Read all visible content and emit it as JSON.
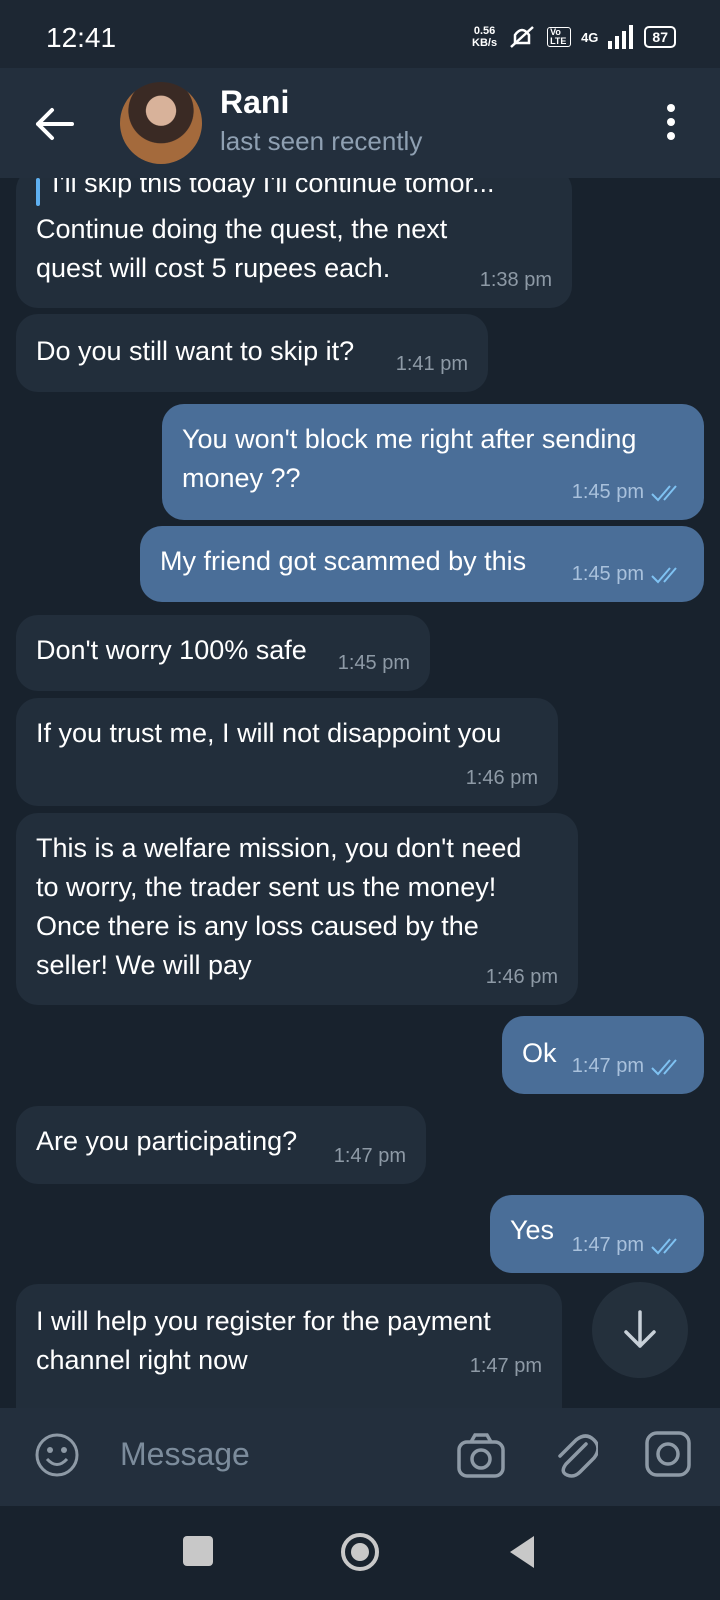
{
  "status": {
    "time": "12:41",
    "net_speed": "0.56",
    "net_unit": "KB/s",
    "volte": "Vo LTE",
    "network": "4G",
    "battery": "87"
  },
  "header": {
    "name": "Rani",
    "status": "last seen recently"
  },
  "messages": [
    {
      "reply_preview": "I'll skip this today I'll continue tomor...",
      "text": [
        "Continue doing the quest, the next",
        "quest will cost 5 rupees each."
      ],
      "time": "1:38 pm",
      "outgoing": false
    },
    {
      "text": [
        "Do you still want to skip it?"
      ],
      "time": "1:41 pm",
      "outgoing": false
    },
    {
      "text": [
        "You won't block me right after sending",
        "money ??"
      ],
      "time": "1:45 pm",
      "outgoing": true
    },
    {
      "text": [
        "My friend got scammed by this"
      ],
      "time": "1:45 pm",
      "outgoing": true
    },
    {
      "text": [
        "Don't worry 100% safe"
      ],
      "time": "1:45 pm",
      "outgoing": false
    },
    {
      "text": [
        "If you trust me, I will not disappoint you"
      ],
      "time": "1:46 pm",
      "outgoing": false
    },
    {
      "text": [
        "This is a welfare mission, you don't need",
        "to worry, the trader sent us the money!",
        "Once there is any loss caused by the",
        "seller! We will pay"
      ],
      "time": "1:46 pm",
      "outgoing": false
    },
    {
      "text": [
        "Ok"
      ],
      "time": "1:47 pm",
      "outgoing": true
    },
    {
      "text": [
        "Are you participating?"
      ],
      "time": "1:47 pm",
      "outgoing": false
    },
    {
      "text": [
        "Yes"
      ],
      "time": "1:47 pm",
      "outgoing": true
    },
    {
      "text": [
        "I will help you register for the payment",
        "channel right now"
      ],
      "time": "1:47 pm",
      "outgoing": false
    }
  ],
  "input": {
    "placeholder": "Message"
  },
  "icons": {
    "back": "arrow-left-icon",
    "menu": "more-vertical-icon",
    "emoji": "smiley-icon",
    "camera": "camera-icon",
    "attach": "paperclip-icon",
    "video": "video-message-icon",
    "scroll_down": "arrow-down-icon"
  },
  "colors": {
    "background": "#18222d",
    "incoming": "#222e3b",
    "outgoing": "#4a6e98",
    "accent": "#5fb0f0"
  }
}
